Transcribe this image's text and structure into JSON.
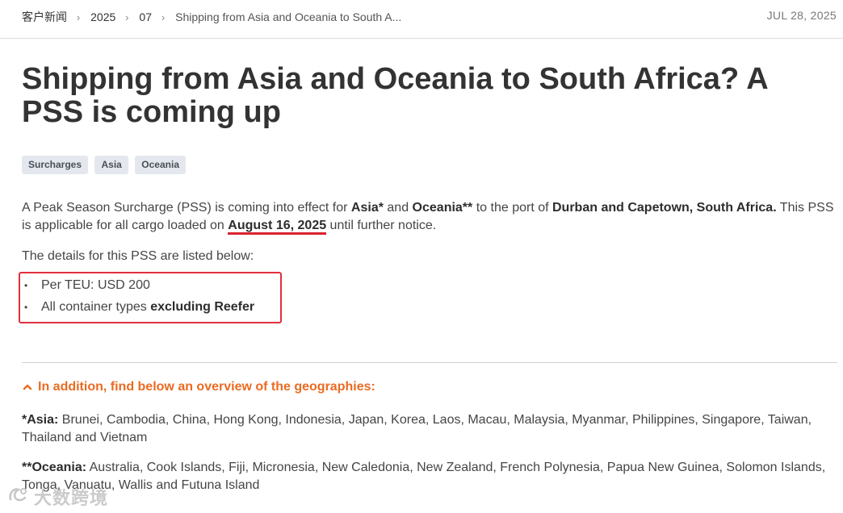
{
  "breadcrumb": {
    "items": [
      "客户新闻",
      "2025",
      "07"
    ],
    "current": "Shipping from Asia and Oceania to South A..."
  },
  "date": "JUL 28, 2025",
  "title": "Shipping from Asia and Oceania to South Africa? A PSS is coming up",
  "tags": [
    "Surcharges",
    "Asia",
    "Oceania"
  ],
  "intro": {
    "t1": "A Peak Season Surcharge (PSS) is coming into effect for ",
    "asia": "Asia*",
    "t2": " and ",
    "oceania": "Oceania**",
    "t3": " to the port of ",
    "ports": "Durban and Capetown, South Africa.",
    "t4": " This PSS is applicable for all cargo loaded on ",
    "effective_date": "August 16, 2025",
    "t5": " until further notice."
  },
  "details_intro": "The details for this PSS are listed below:",
  "details": {
    "item1": "Per TEU: USD 200",
    "item2_prefix": "All container types ",
    "item2_bold": "excluding Reefer"
  },
  "geographies": {
    "toggle_label": "In addition, find below an overview of the geographies:",
    "asia_label": "*Asia:",
    "asia_list": " Brunei, Cambodia, China, Hong Kong, Indonesia, Japan, Korea, Laos, Macau, Malaysia, Myanmar, Philippines, Singapore, Taiwan, Thailand and Vietnam",
    "oceania_label": "**Oceania:",
    "oceania_list": " Australia, Cook Islands, Fiji, Micronesia, New Caledonia, New Zealand, French Polynesia, Papua New Guinea, Solomon Islands, Tonga, Vanuatu, Wallis and Futuna Island"
  },
  "watermark": "大数跨境",
  "colors": {
    "accent_orange": "#ea6b22",
    "highlight_red": "#e0303c",
    "tag_bg": "#e4e8ee"
  },
  "icons": [
    "chevron-right-icon",
    "chevron-up-icon"
  ]
}
